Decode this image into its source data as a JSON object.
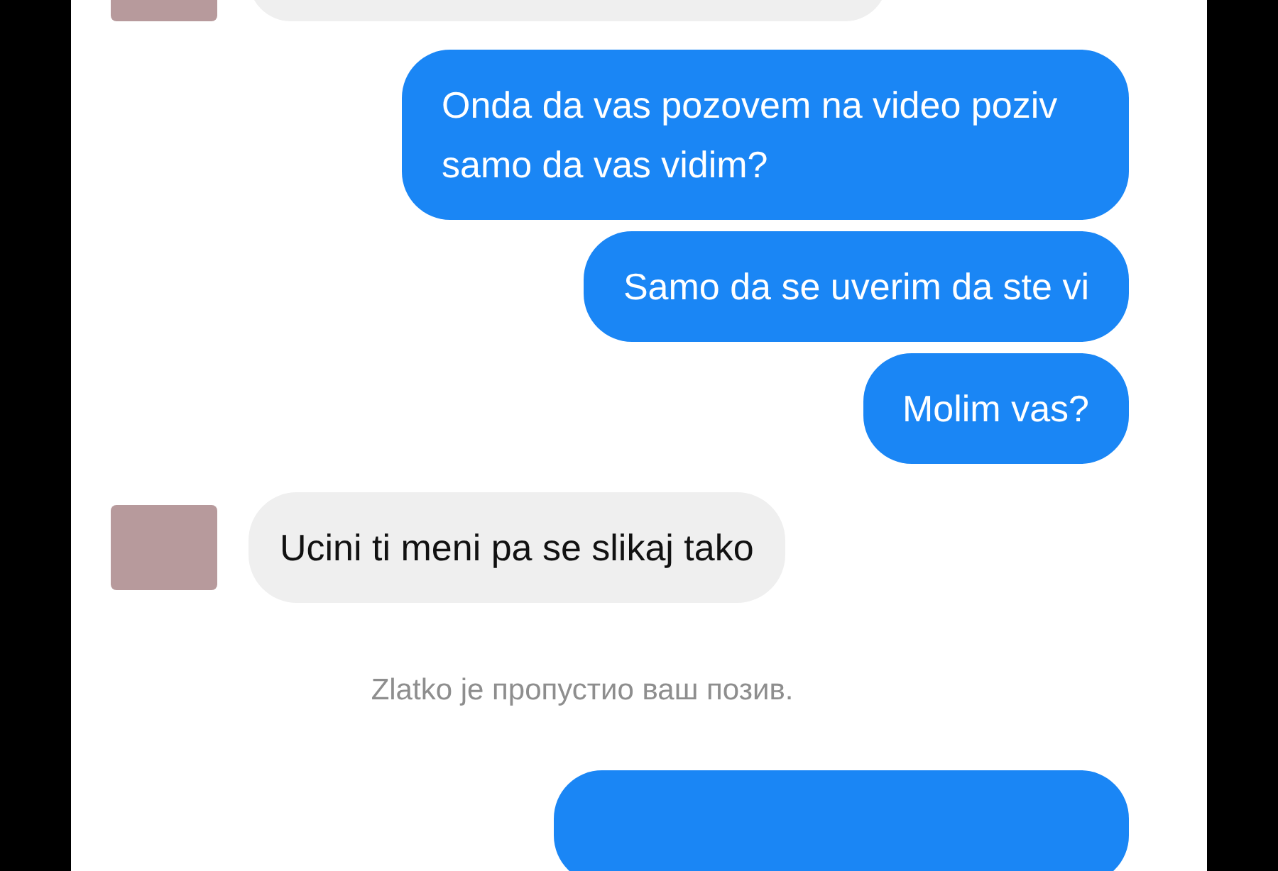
{
  "messages": [
    {
      "kind": "incoming"
    },
    {
      "kind": "outgoing",
      "text": "Onda da vas pozovem na video poziv samo da vas vidim?"
    },
    {
      "kind": "outgoing",
      "text": "Samo da se uverim da ste vi"
    },
    {
      "kind": "outgoing",
      "text": "Molim vas?"
    },
    {
      "kind": "incoming",
      "text": "Ucini ti meni pa se slikaj tako"
    },
    {
      "kind": "system",
      "text": "Zlatko je пропустио ваш позив."
    },
    {
      "kind": "outgoing"
    }
  ]
}
